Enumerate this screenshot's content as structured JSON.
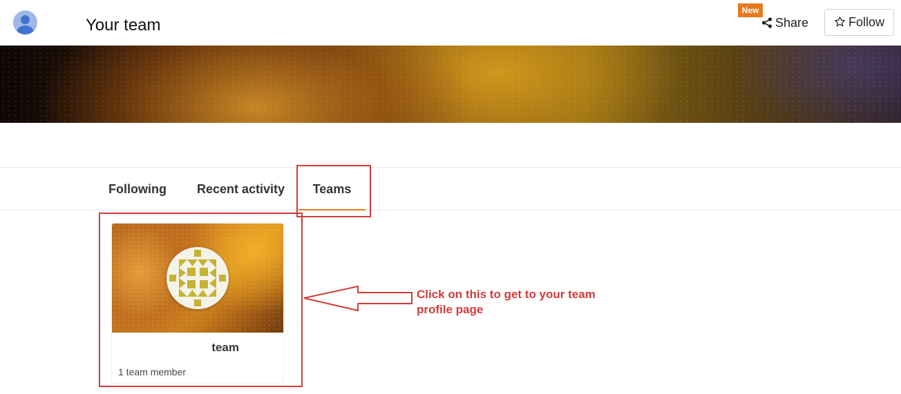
{
  "header": {
    "title": "Your team",
    "avatar_icon": "user-avatar-icon",
    "new_badge": "New",
    "share_label": "Share",
    "share_icon": "share-icon",
    "follow_label": "Follow",
    "follow_icon": "star-outline-icon"
  },
  "tabs": [
    {
      "label": "Following",
      "active": false
    },
    {
      "label": "Recent activity",
      "active": false
    },
    {
      "label": "Teams",
      "active": true
    }
  ],
  "team_card": {
    "name": "team",
    "members": "1 team member"
  },
  "annotation": {
    "text": "Click on this to get to your team profile page",
    "color": "#d43a3a"
  },
  "colors": {
    "accent": "#e8791c",
    "annotation": "#d43a3a"
  }
}
